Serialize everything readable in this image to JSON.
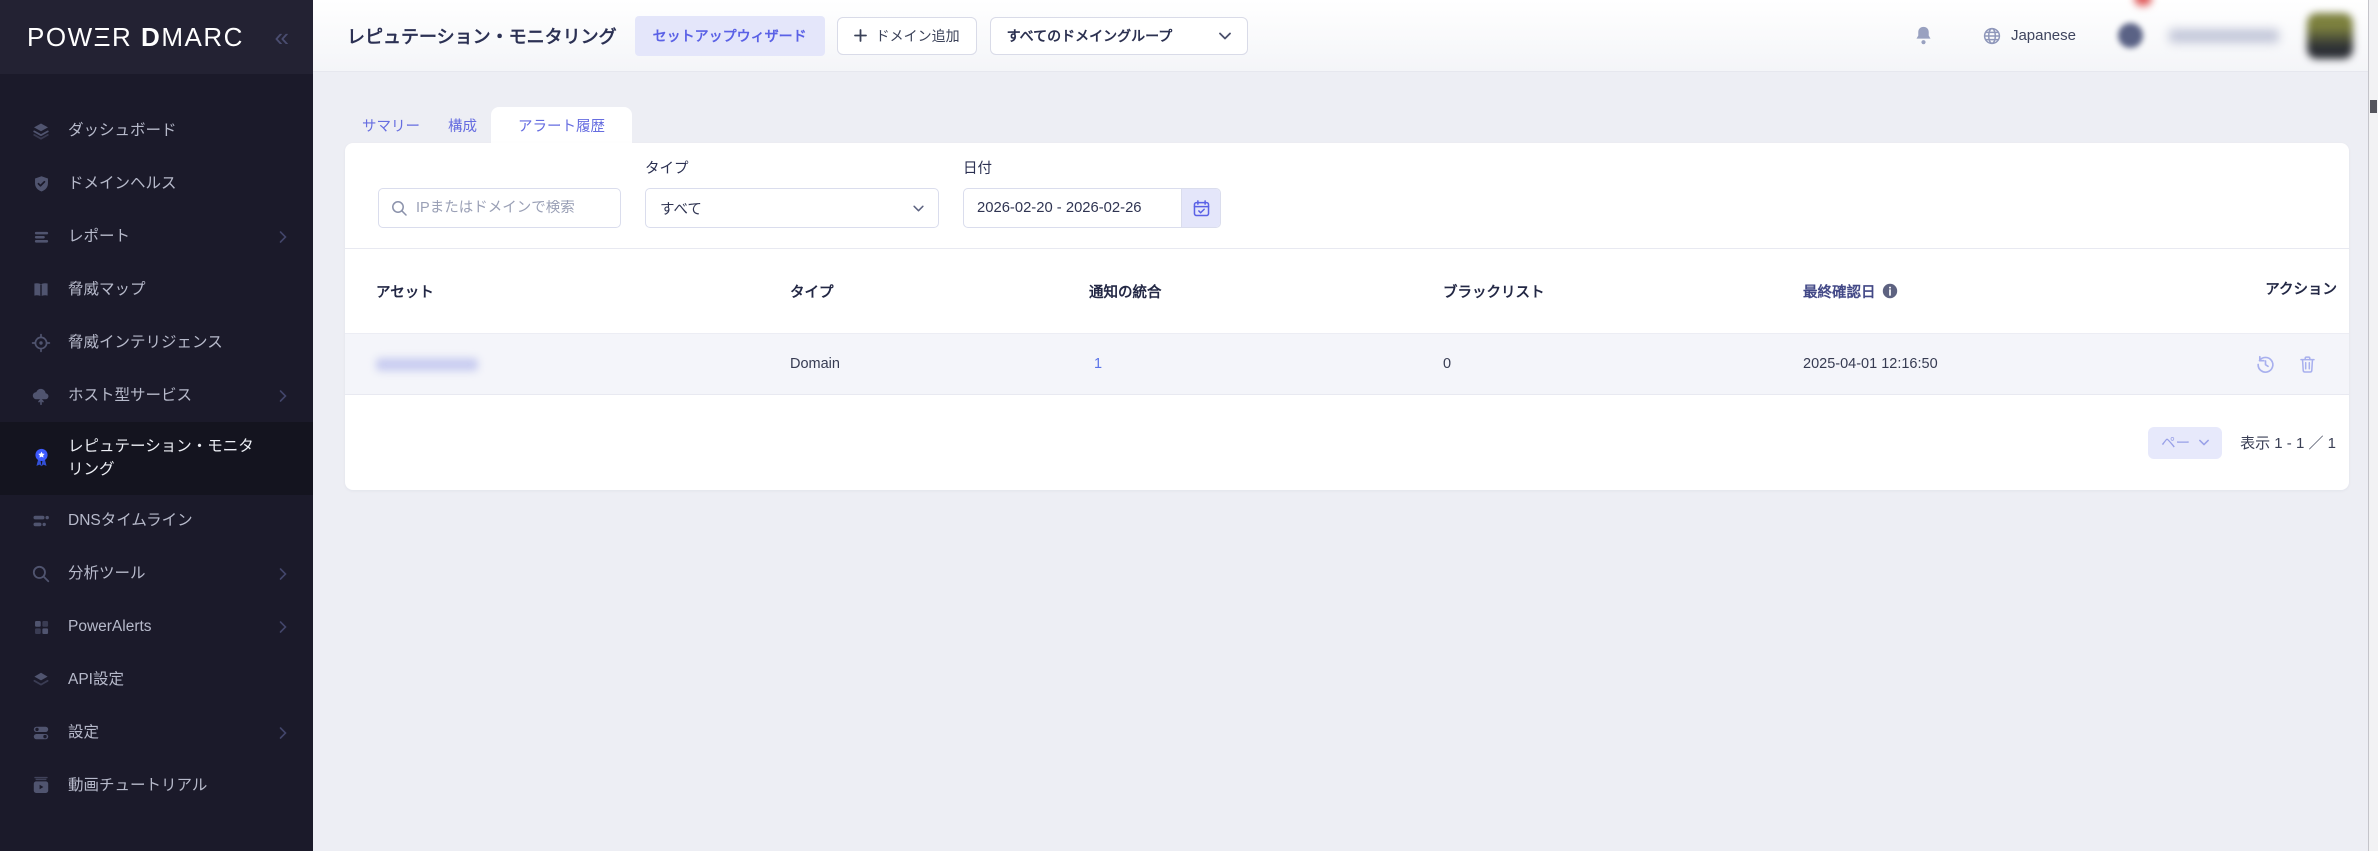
{
  "brand": {
    "logo_p1": "POW",
    "logo_e": "Ξ",
    "logo_p2": "R",
    "logo_d": "D",
    "logo_p3": "MARC",
    "collapse_icon": "«"
  },
  "sidebar": {
    "items": [
      {
        "label": "ダッシュボード",
        "icon": "dashboard-icon",
        "expandable": false,
        "active": false
      },
      {
        "label": "ドメインヘルス",
        "icon": "domain-health-icon",
        "expandable": false,
        "active": false
      },
      {
        "label": "レポート",
        "icon": "reports-icon",
        "expandable": true,
        "active": false
      },
      {
        "label": "脅威マップ",
        "icon": "threat-map-icon",
        "expandable": false,
        "active": false
      },
      {
        "label": "脅威インテリジェンス",
        "icon": "threat-intelligence-icon",
        "expandable": false,
        "active": false
      },
      {
        "label": "ホスト型サービス",
        "icon": "hosted-services-icon",
        "expandable": true,
        "active": false
      },
      {
        "label": "レピュテーション・モニタリング",
        "icon": "reputation-monitoring-icon",
        "expandable": false,
        "active": true
      },
      {
        "label": "DNSタイムライン",
        "icon": "dns-timeline-icon",
        "expandable": false,
        "active": false
      },
      {
        "label": "分析ツール",
        "icon": "analysis-tools-icon",
        "expandable": true,
        "active": false
      },
      {
        "label": "PowerAlerts",
        "icon": "poweralerts-icon",
        "expandable": true,
        "active": false
      },
      {
        "label": "API設定",
        "icon": "api-settings-icon",
        "expandable": false,
        "active": false
      },
      {
        "label": "設定",
        "icon": "settings-icon",
        "expandable": true,
        "active": false
      },
      {
        "label": "動画チュートリアル",
        "icon": "video-tutorials-icon",
        "expandable": false,
        "active": false
      }
    ]
  },
  "header": {
    "title": "レピュテーション・モニタリング",
    "setup_wizard_label": "セットアップウィザード",
    "add_domain_label": "ドメイン追加",
    "domain_group_value": "すべてのドメイングループ",
    "language": "Japanese",
    "user_name_redacted": true
  },
  "tabs": [
    {
      "label": "サマリー",
      "active": false
    },
    {
      "label": "構成",
      "active": false
    },
    {
      "label": "アラート履歴",
      "active": true
    }
  ],
  "filters": {
    "search_placeholder": "IPまたはドメインで検索",
    "type_label": "タイプ",
    "type_value": "すべて",
    "date_label": "日付",
    "date_value": "2026-02-20 - 2026-02-26"
  },
  "table": {
    "columns": [
      "アセット",
      "タイプ",
      "通知の統合",
      "ブラックリスト",
      "最終確認日",
      "アクション"
    ],
    "rows": [
      {
        "asset_redacted": true,
        "type": "Domain",
        "notification_integrations": "1",
        "blacklists": "0",
        "last_checked": "2025-04-01 12:16:50"
      }
    ]
  },
  "pagination": {
    "page_size_label": "ペー",
    "summary": "表示 1 - 1 ／ 1"
  },
  "colors": {
    "accent": "#5a61e6",
    "sidebar_bg": "#1b1a2a",
    "active_icon_blue": "#3d5afe",
    "link_blue": "#5b74e8",
    "badge_red": "#e05f5f"
  }
}
